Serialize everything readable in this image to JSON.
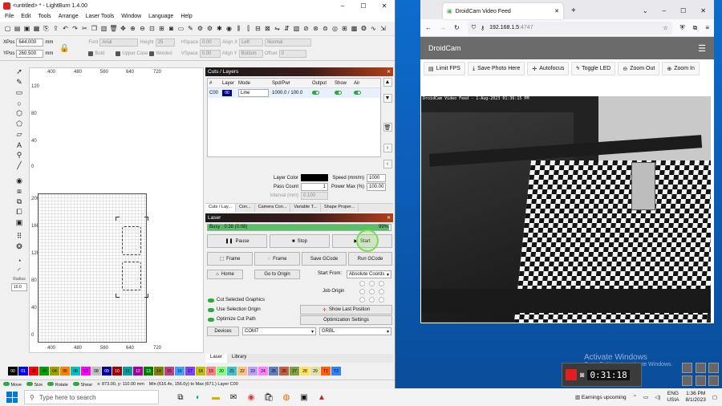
{
  "lightburn": {
    "title": "<untitled> * - LightBurn 1.4.00",
    "menu": [
      "File",
      "Edit",
      "Tools",
      "Arrange",
      "Laser Tools",
      "Window",
      "Language",
      "Help"
    ],
    "props": {
      "xpos_label": "XPos",
      "xpos": "644.000",
      "ypos_label": "YPos",
      "ypos": "260.500",
      "unit": "mm",
      "font_label": "Font",
      "font": "Arial",
      "height_label": "Height",
      "height": "25",
      "bold": "Bold",
      "italic": "Italic",
      "upper": "Upper Case",
      "welded": "Welded",
      "distort": "Distort",
      "hspace_label": "HSpace",
      "hspace": "0.00",
      "vspace_label": "VSpace",
      "vspace": "0.00",
      "alignx_label": "Align X",
      "alignx": "Left",
      "aligny_label": "Align Y",
      "aligny": "Bottom",
      "normal": "Normal",
      "offset_label": "Offset",
      "offset": "0"
    },
    "tools": {
      "radius_label": "Radius",
      "radius": "10.0"
    },
    "ruler_top": [
      "400",
      "480",
      "560",
      "640",
      "720"
    ],
    "ruler_bottom": [
      "400",
      "480",
      "560",
      "640",
      "720"
    ],
    "ruler_left": [
      "120",
      "80",
      "40",
      "0",
      "200",
      "160",
      "120",
      "80",
      "40",
      "0"
    ],
    "cuts": {
      "header": "Cuts / Layers",
      "cols": [
        "#",
        "Layer",
        "Mode",
        "Spd/Pwr",
        "Output",
        "Show",
        "Air"
      ],
      "row": {
        "num": "C00",
        "layer": "00",
        "mode": "Line",
        "spdpwr": "1000.0 / 100.0"
      },
      "layer_color_label": "Layer Color",
      "speed_label": "Speed (mm/m)",
      "speed": "1000",
      "pass_label": "Pass Count",
      "pass": "1",
      "power_label": "Power Max (%)",
      "power": "100.00",
      "interval_label": "Interval (mm)",
      "interval": "0.100"
    },
    "tabs1": [
      "Cuts / Lay...",
      "Con...",
      "Camera Con...",
      "Variable T...",
      "Shape Proper..."
    ],
    "laser": {
      "header": "Laser",
      "busy": "Busy : 0:38 (0:08)",
      "progress_pct": "99%",
      "progress": 0.99,
      "pause": "Pause",
      "stop": "Stop",
      "start": "Start",
      "frame1": "Frame",
      "frame2": "Frame",
      "save_gcode": "Save GCode",
      "run_gcode": "Run GCode",
      "home": "Home",
      "goto_origin": "Go to Origin",
      "start_from_label": "Start From:",
      "start_from": "Absolute Coords",
      "job_origin": "Job Origin",
      "cut_selected": "Cut Selected Graphics",
      "use_selection": "Use Selection Origin",
      "optimize": "Optimize Cut Path",
      "show_last": "Show Last Position",
      "opt_settings": "Optimization Settings",
      "devices": "Devices",
      "port": "COM7",
      "controller": "GRBL"
    },
    "tabs2": [
      "Laser",
      "Library"
    ],
    "palette": [
      {
        "label": "00",
        "color": "#000000"
      },
      {
        "label": "01",
        "color": "#0000ff"
      },
      {
        "label": "02",
        "color": "#ff0000"
      },
      {
        "label": "03",
        "color": "#00a000"
      },
      {
        "label": "04",
        "color": "#a0a000"
      },
      {
        "label": "05",
        "color": "#ff8000"
      },
      {
        "label": "06",
        "color": "#00c0c0"
      },
      {
        "label": "07",
        "color": "#ff00ff"
      },
      {
        "label": "08",
        "color": "#c0c0c0"
      },
      {
        "label": "09",
        "color": "#0000a0"
      },
      {
        "label": "10",
        "color": "#a00000"
      },
      {
        "label": "11",
        "color": "#00a0a0"
      },
      {
        "label": "12",
        "color": "#a000a0"
      },
      {
        "label": "13",
        "color": "#008000"
      },
      {
        "label": "14",
        "color": "#808000"
      },
      {
        "label": "15",
        "color": "#c04080"
      },
      {
        "label": "16",
        "color": "#40a0ff"
      },
      {
        "label": "17",
        "color": "#8040ff"
      },
      {
        "label": "18",
        "color": "#c0c000"
      },
      {
        "label": "19",
        "color": "#ff8080"
      },
      {
        "label": "20",
        "color": "#80ff80"
      },
      {
        "label": "21",
        "color": "#40c0c0"
      },
      {
        "label": "22",
        "color": "#ffc080"
      },
      {
        "label": "23",
        "color": "#c0a0ff"
      },
      {
        "label": "24",
        "color": "#ff80ff"
      },
      {
        "label": "25",
        "color": "#6080c0"
      },
      {
        "label": "26",
        "color": "#c06040"
      },
      {
        "label": "27",
        "color": "#80a040"
      },
      {
        "label": "28",
        "color": "#ffe060"
      },
      {
        "label": "29",
        "color": "#e0e0a0"
      },
      {
        "label": "T1",
        "color": "#ff6000"
      },
      {
        "label": "T2",
        "color": "#3080ff"
      }
    ],
    "status": {
      "move": "Move",
      "size": "Size",
      "rotate": "Rotate",
      "shear": "Shear",
      "coords": "x: 873.00, y: 110.00 mm",
      "minmax": "Min (616.4x, 156.0y) to Max (671.) Layer C00"
    }
  },
  "browser": {
    "tab_title": "DroidCam Video Feed",
    "url_host": "192.168.1.5",
    "url_port": ":4747",
    "app_title": "DroidCam",
    "buttons": [
      "Limit FPS",
      "Save Photo Here",
      "Autofocus",
      "Toggle LED",
      "Zoom Out",
      "Zoom In"
    ],
    "feed_label": "DroidCam Video Feed - 1-Aug-2023 01:36:15 PM"
  },
  "overlay": {
    "activate_title": "Activate Windows",
    "activate_sub": "Go to Settings to activate Windows.",
    "timer": "0:31:18"
  },
  "taskbar": {
    "search_placeholder": "Type here to search",
    "news": "Earnings upcoming",
    "lang": "ENG",
    "region": "USIA",
    "time": "1:36 PM",
    "date": "8/1/2023"
  }
}
